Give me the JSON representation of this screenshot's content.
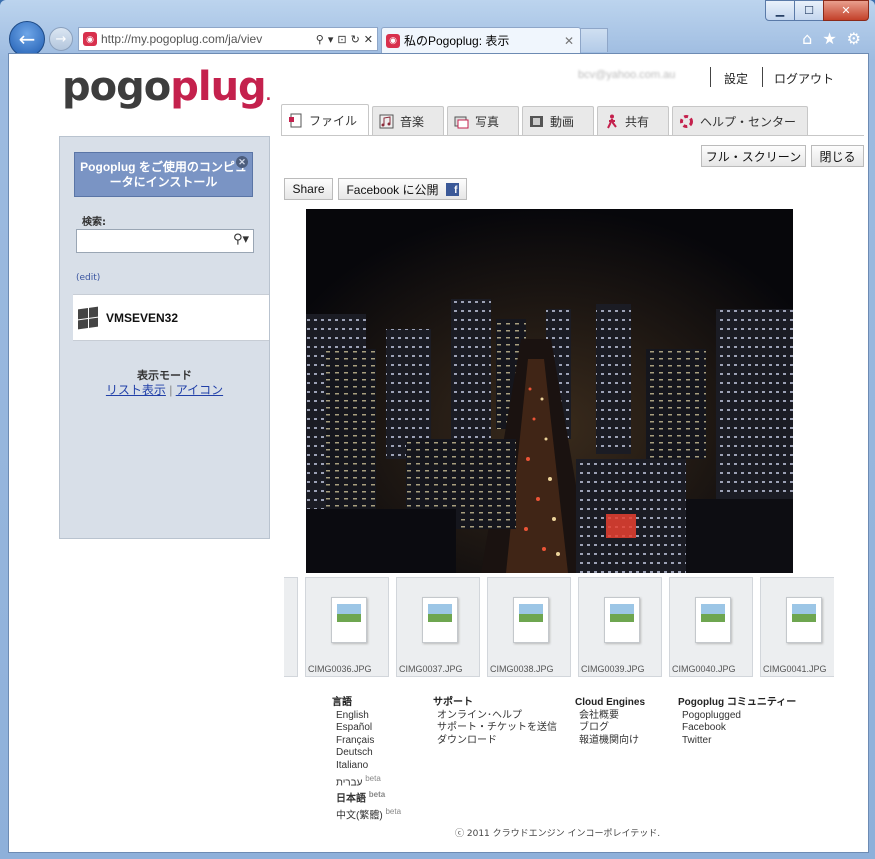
{
  "browser": {
    "address": "http://my.pogoplug.com/ja/viev",
    "tab_title": "私のPogoplug: 表示",
    "favicon": "pogoplug-icon"
  },
  "header": {
    "logo_pogo": "pogo",
    "logo_plug": "plug",
    "logo_dot": ".",
    "user_email": "bcv@yahoo.com.au",
    "settings": "設定",
    "logout": "ログアウト"
  },
  "tabs": [
    {
      "label": "ファイル",
      "icon": "file-icon"
    },
    {
      "label": "音楽",
      "icon": "music-icon"
    },
    {
      "label": "写真",
      "icon": "photo-icon"
    },
    {
      "label": "動画",
      "icon": "film-icon"
    },
    {
      "label": "共有",
      "icon": "share-person-icon"
    },
    {
      "label": "ヘルプ・センター",
      "icon": "help-icon"
    }
  ],
  "sidebar": {
    "install_text": "Pogoplug をご使用のコンピュータにインストール",
    "search_label": "検索:",
    "search_placeholder": "",
    "edit": "(edit)",
    "device_name": "VMSEVEN32",
    "mode_label": "表示モード",
    "mode_list": "リスト表示",
    "mode_sep": " | ",
    "mode_icon": "アイコン"
  },
  "toolbar": {
    "fullscreen": "フル・スクリーン",
    "close": "閉じる",
    "share": "Share",
    "facebook": "Facebook に公開"
  },
  "thumbnails": [
    "CIMG0036.JPG",
    "CIMG0037.JPG",
    "CIMG0038.JPG",
    "CIMG0039.JPG",
    "CIMG0040.JPG",
    "CIMG0041.JPG"
  ],
  "footer": {
    "lang_head": "言語",
    "languages": [
      {
        "name": "English",
        "beta": ""
      },
      {
        "name": "Español",
        "beta": ""
      },
      {
        "name": "Français",
        "beta": ""
      },
      {
        "name": "Deutsch",
        "beta": ""
      },
      {
        "name": "Italiano",
        "beta": ""
      },
      {
        "name": "עברית",
        "beta": "beta"
      },
      {
        "name": "日本語",
        "beta": "beta"
      },
      {
        "name": "中文(繁體)",
        "beta": "beta"
      }
    ],
    "support_head": "サポート",
    "support": [
      "オンライン･ヘルプ",
      "サポート・チケットを送信",
      "ダウンロード"
    ],
    "ce_head": "Cloud Engines",
    "ce": [
      "会社概要",
      "ブログ",
      "報道機関向け"
    ],
    "community_head": "Pogoplug コミュニティー",
    "community": [
      "Pogoplugged",
      "Facebook",
      "Twitter"
    ],
    "copyright": "ⓒ 2011 クラウドエンジン インコーポレイテッド."
  }
}
